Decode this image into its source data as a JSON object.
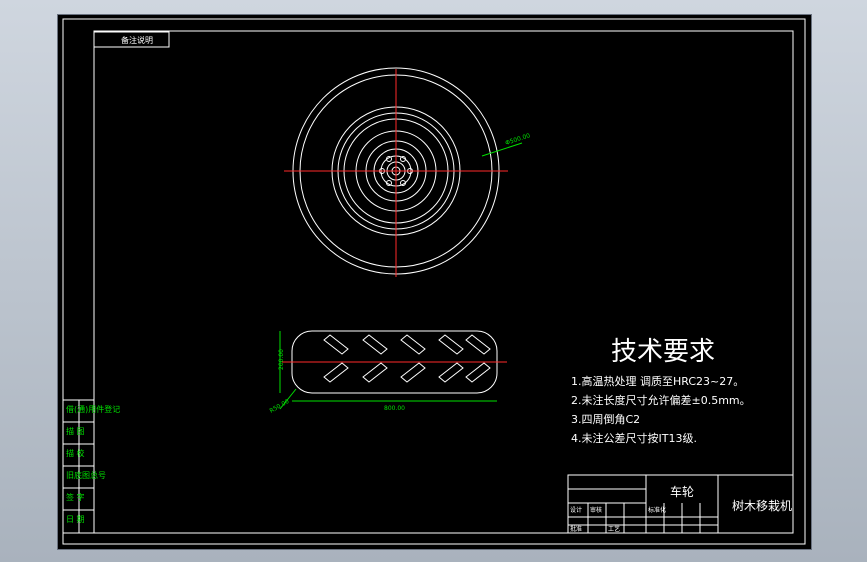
{
  "drawing": {
    "background": "#000000",
    "line_color": "#ffffff",
    "center_line_color": "#ff2a2a",
    "dimension_color": "#00e000",
    "corner_tag": "备注说明"
  },
  "tech_requirements": {
    "title": "技术要求",
    "items": [
      "1.高温热处理 调质至HRC23~27。",
      "2.未注长度尺寸允许偏差±0.5mm。",
      "3.四周倒角C2",
      "4.未注公差尺寸按IT13级."
    ]
  },
  "title_block": {
    "part_name": "车轮",
    "company": "树木移栽机",
    "sub_labels": [
      "设计",
      "审核",
      "标准化",
      "批准",
      "工艺"
    ]
  },
  "side_labels": [
    "借(通)用件登记",
    "描 图",
    "描 校",
    "旧底图总号",
    "签 字",
    "日 期"
  ],
  "dimensions": {
    "outer_dia": "Φ500.00",
    "width": "800.00",
    "height": "200.00",
    "radius": "R50.00"
  }
}
